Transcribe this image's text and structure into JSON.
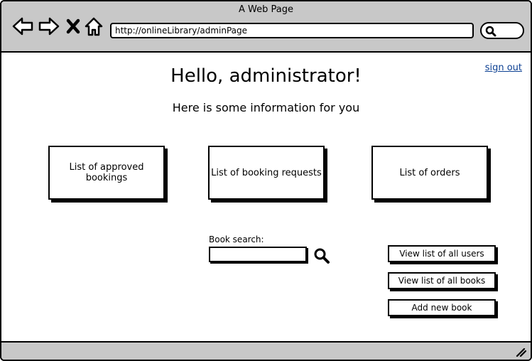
{
  "browser": {
    "window_title": "A Web Page",
    "url": "http://onlineLibrary/adminPage",
    "icons": {
      "back": "arrow-left-icon",
      "forward": "arrow-right-icon",
      "stop": "close-icon",
      "home": "home-icon",
      "search": "search-icon"
    }
  },
  "header": {
    "greeting": "Hello, administrator!",
    "subtitle": "Here is some information for you",
    "sign_out": "sign out"
  },
  "cards": [
    {
      "label": "List of approved bookings"
    },
    {
      "label": "List of booking requests"
    },
    {
      "label": "List of orders"
    }
  ],
  "book_search": {
    "label": "Book search:",
    "value": "",
    "placeholder": ""
  },
  "actions": [
    {
      "label": "View list of all users"
    },
    {
      "label": "View list of all books"
    },
    {
      "label": "Add new book"
    }
  ],
  "colors": {
    "chrome": "#c8c8c8",
    "link": "#0b3f92"
  }
}
